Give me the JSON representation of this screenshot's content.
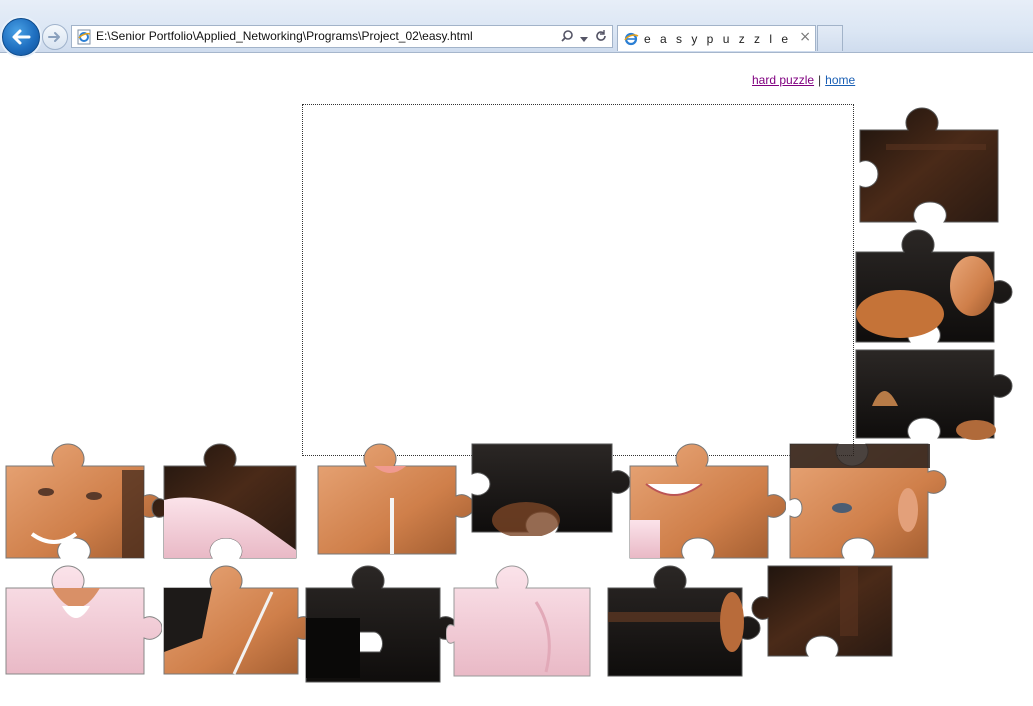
{
  "browser": {
    "address_url": "E:\\Senior Portfolio\\Applied_Networking\\Programs\\Project_02\\easy.html",
    "tab_title": "e a s y p u z z l e",
    "tab_close_glyph": "×",
    "icons": [
      "back-arrow-icon",
      "forward-arrow-icon",
      "ie-page-icon",
      "search-icon",
      "dropdown-arrow-icon",
      "refresh-icon",
      "close-icon"
    ]
  },
  "page": {
    "links": {
      "hard_puzzle": "hard puzzle",
      "separator": "|",
      "home": "home"
    }
  },
  "colors": {
    "chrome_blue": "#1f6fc0",
    "link_visited": "#800080",
    "link_unvisited": "#1a5fb4",
    "dark_wood": "#3a2418",
    "skin": "#d98f5a",
    "shirt_pink": "#f3cfd8"
  }
}
